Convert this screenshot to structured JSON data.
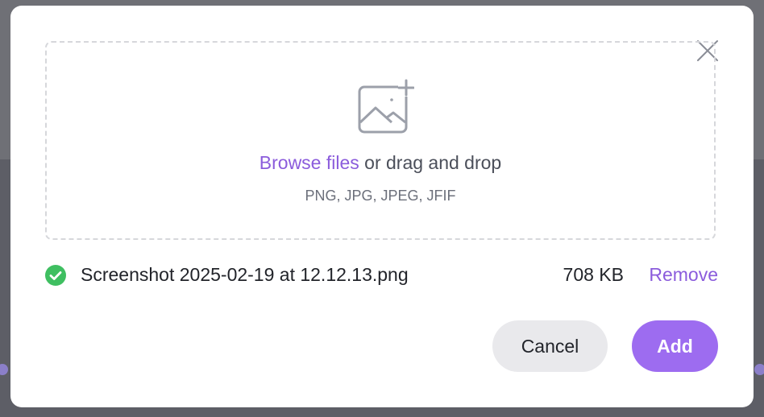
{
  "dialog": {
    "dropzone": {
      "icon": "image-add-icon",
      "browse_label": "Browse files",
      "drag_text": " or drag and drop",
      "accepted_types": "PNG, JPG, JPEG, JFIF"
    },
    "file": {
      "name": "Screenshot 2025-02-19 at 12.12.13.png",
      "size": "708 KB",
      "remove_label": "Remove",
      "status_icon": "check-circle-icon"
    },
    "actions": {
      "cancel_label": "Cancel",
      "add_label": "Add"
    },
    "close_icon": "close-icon"
  },
  "colors": {
    "accent": "#8b5cdc",
    "primary_button": "#9d6cf0",
    "success": "#3fbf61",
    "secondary_button": "#e9e9ec"
  }
}
